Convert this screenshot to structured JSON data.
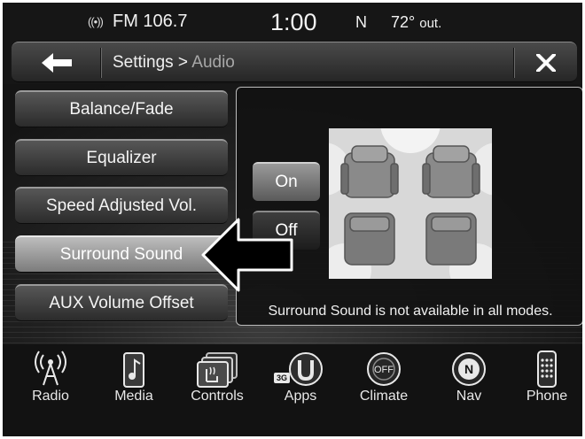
{
  "status_bar": {
    "station": "FM 106.7",
    "time": "1:00",
    "compass_heading": "N",
    "temperature": "72°",
    "temperature_suffix": "out."
  },
  "title_bar": {
    "breadcrumb_parent": "Settings",
    "breadcrumb_separator": " > ",
    "breadcrumb_current": "Audio"
  },
  "audio_menu": {
    "items": [
      {
        "label": "Balance/Fade"
      },
      {
        "label": "Equalizer"
      },
      {
        "label": "Speed Adjusted Vol."
      },
      {
        "label": "Surround Sound",
        "selected": true
      },
      {
        "label": "AUX Volume Offset"
      }
    ]
  },
  "surround_panel": {
    "on_label": "On",
    "off_label": "Off",
    "selected": "On",
    "note": "Surround Sound is not available in all modes."
  },
  "dock": {
    "items": [
      {
        "label": "Radio",
        "icon": "antenna-icon"
      },
      {
        "label": "Media",
        "icon": "music-note-icon"
      },
      {
        "label": "Controls",
        "icon": "heated-seat-icon"
      },
      {
        "label": "Apps",
        "icon": "uconnect-apps-icon",
        "badge": "3G"
      },
      {
        "label": "Climate",
        "icon": "climate-off-icon",
        "icon_text": "OFF"
      },
      {
        "label": "Nav",
        "icon": "compass-icon",
        "icon_text": "N"
      },
      {
        "label": "Phone",
        "icon": "phone-keypad-icon"
      }
    ]
  },
  "colors": {
    "screen_background": "#161616",
    "selected_button": "#a9a9a9",
    "panel_border": "#bdbdbd"
  }
}
